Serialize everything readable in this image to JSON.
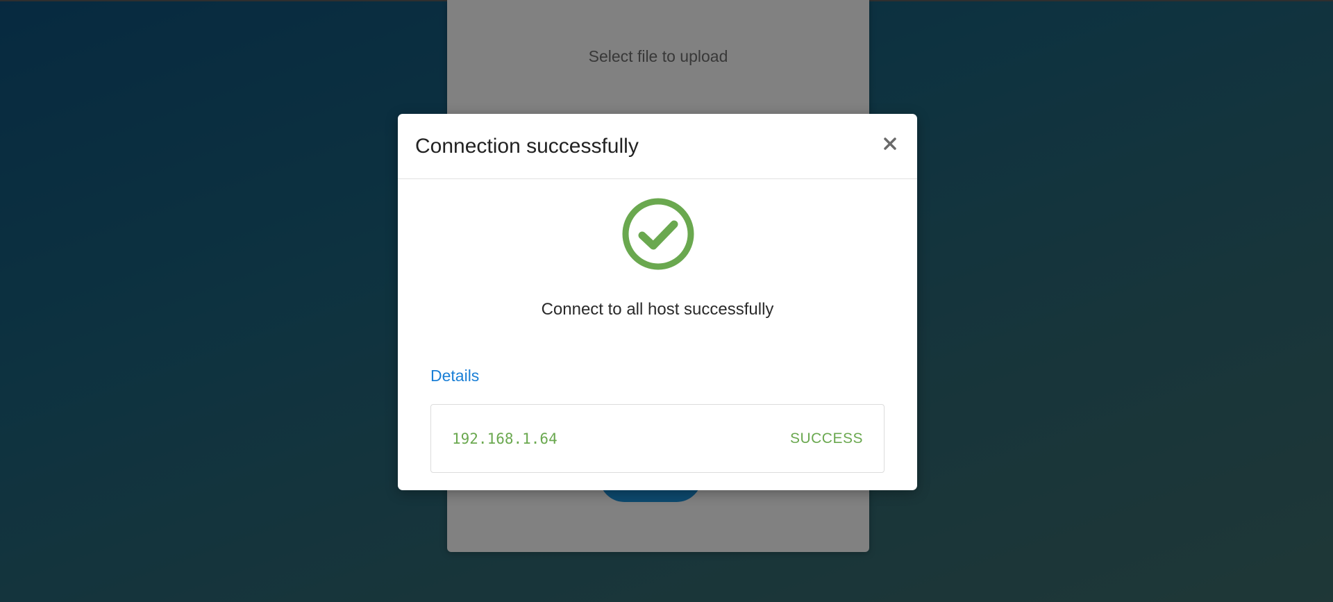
{
  "background_page": {
    "upload_panel_title": "Select file to upload"
  },
  "modal": {
    "title": "Connection successfully",
    "close_icon": "close-icon",
    "status_icon": "check-circle-icon",
    "status_color": "#6aa84f",
    "message": "Connect to all host successfully",
    "details_link": "Details",
    "details_link_color": "#1a7fd6",
    "hosts": [
      {
        "ip": "192.168.1.64",
        "status": "SUCCESS"
      }
    ]
  }
}
